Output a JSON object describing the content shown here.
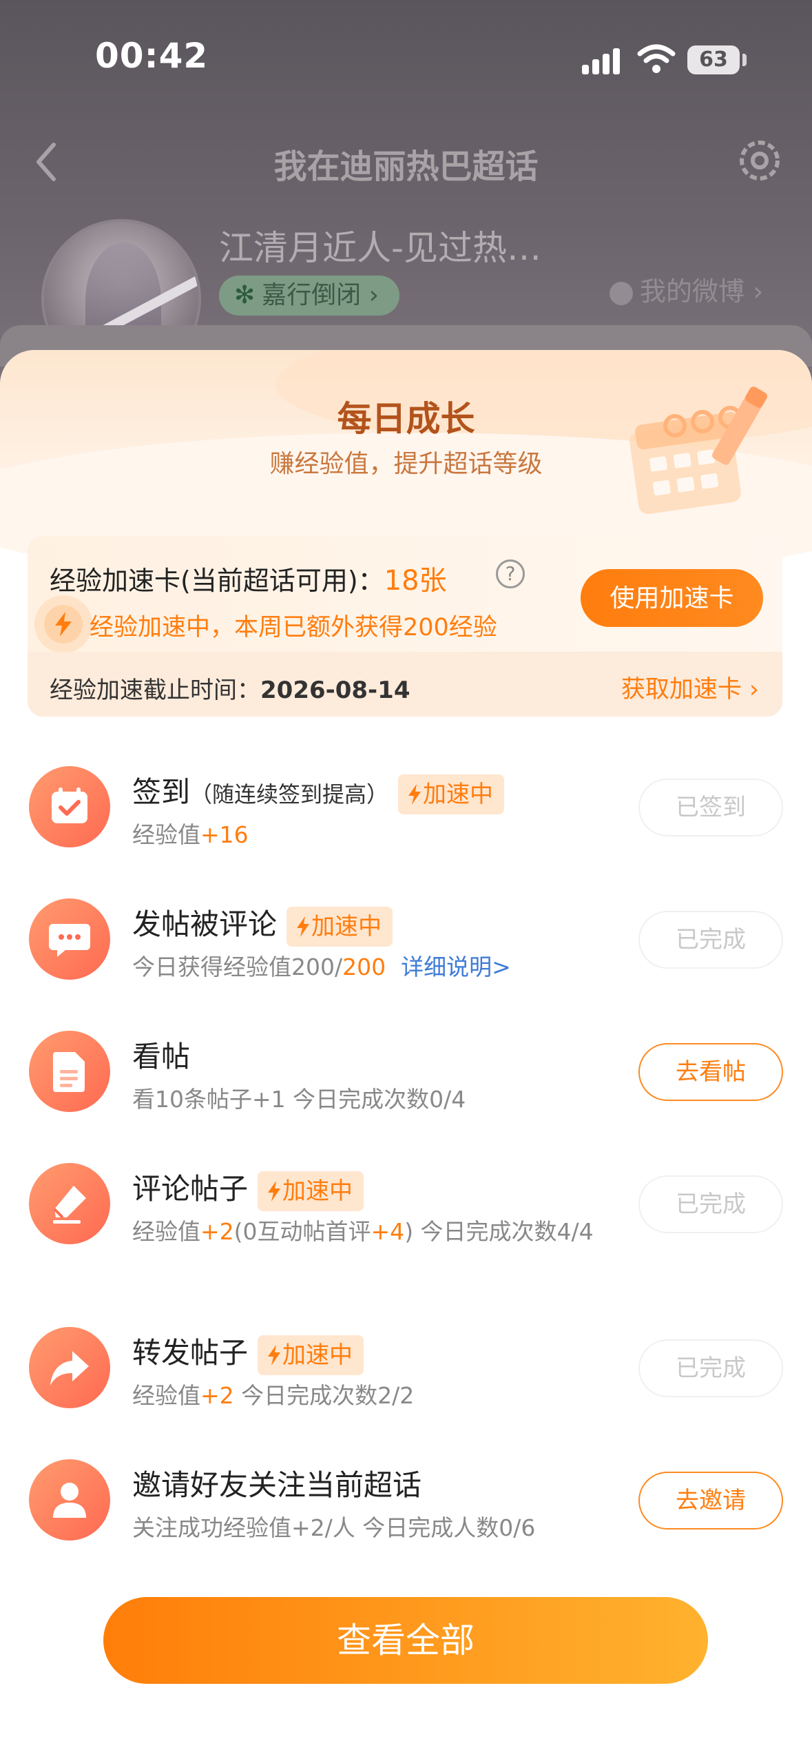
{
  "status_bar": {
    "time": "00:42",
    "battery": "63"
  },
  "nav": {
    "title": "我在迪丽热巴超话"
  },
  "profile": {
    "name": "江清月近人-见过热…",
    "tag": "嘉行倒闭",
    "tag_chevron": "›",
    "my_weibo": "我的微博 ›"
  },
  "sheet": {
    "title": "每日成长",
    "subtitle": "赚经验值，提升超话等级"
  },
  "speed_card": {
    "label": "经验加速卡(当前超话可用)：",
    "count": "18张",
    "help": "?",
    "status": "经验加速中，本周已额外获得200经验",
    "use_button": "使用加速卡",
    "deadline_label": "经验加速截止时间：",
    "deadline_date": "2026-08-14",
    "get_link": "获取加速卡 ›"
  },
  "boost_label": "加速中",
  "tasks": [
    {
      "title": "签到",
      "note": "（随连续签到提高）",
      "boost": true,
      "desc_prefix": "经验值",
      "desc_hl": "+16",
      "button": "已签到",
      "button_state": "done",
      "icon": "calendar-check-icon"
    },
    {
      "title": "发帖被评论",
      "boost": true,
      "desc_prefix": "今日获得经验值200/",
      "desc_hl": "200",
      "link": "详细说明>",
      "button": "已完成",
      "button_state": "done",
      "icon": "chat-bubble-icon"
    },
    {
      "title": "看帖",
      "boost": false,
      "desc_prefix": "看10条帖子+1   今日完成次数0/4",
      "button": "去看帖",
      "button_state": "go",
      "icon": "document-icon"
    },
    {
      "title": "评论帖子",
      "boost": true,
      "desc_a": "经验值",
      "desc_b": "+2",
      "desc_c": "(0互动帖首评",
      "desc_d": "+4",
      "desc_e": ")   今日完成次数4/4",
      "button": "已完成",
      "button_state": "done",
      "icon": "eraser-pen-icon"
    },
    {
      "title": "转发帖子",
      "boost": true,
      "desc_a": "经验值",
      "desc_b": "+2",
      "desc_c": "   今日完成次数2/2",
      "button": "已完成",
      "button_state": "done",
      "icon": "share-arrow-icon"
    },
    {
      "title": "邀请好友关注当前超话",
      "boost": false,
      "desc_prefix": "关注成功经验值+2/人   今日完成人数0/6",
      "button": "去邀请",
      "button_state": "go",
      "icon": "person-icon"
    }
  ],
  "view_all": "查看全部",
  "colors": {
    "accent": "#ff7d0e",
    "link": "#3e7bd6",
    "icon_bg": "#ff7a5c"
  }
}
